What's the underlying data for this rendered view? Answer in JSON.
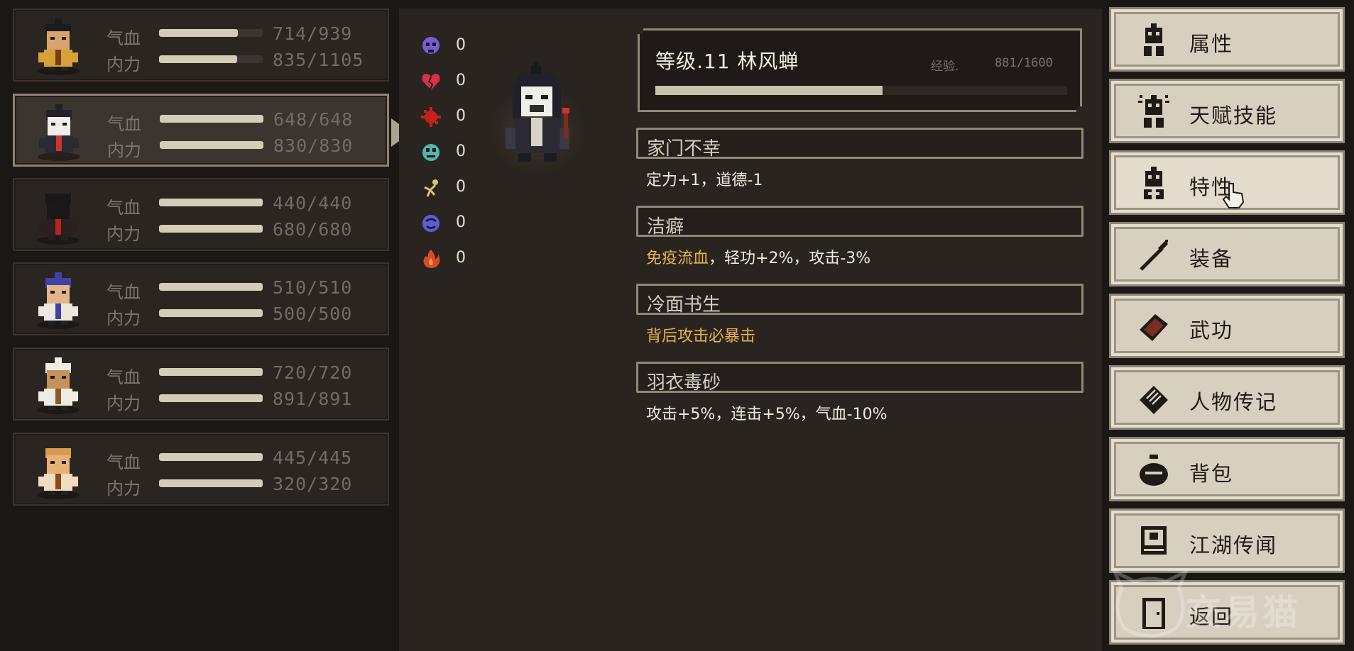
{
  "party": [
    {
      "hp_label": "气血",
      "hp": 714,
      "hp_max": 939,
      "hp_text": "714/939",
      "mp_label": "内力",
      "mp": 835,
      "mp_max": 1105,
      "mp_text": "835/1105",
      "selected": false,
      "avatar": "warrior-portrait"
    },
    {
      "hp_label": "气血",
      "hp": 648,
      "hp_max": 648,
      "hp_text": "648/648",
      "mp_label": "内力",
      "mp": 830,
      "mp_max": 830,
      "mp_text": "830/830",
      "selected": true,
      "avatar": "masked-scholar-portrait"
    },
    {
      "hp_label": "气血",
      "hp": 440,
      "hp_max": 440,
      "hp_text": "440/440",
      "mp_label": "内力",
      "mp": 680,
      "mp_max": 680,
      "mp_text": "680/680",
      "selected": false,
      "avatar": "ninja-portrait"
    },
    {
      "hp_label": "气血",
      "hp": 510,
      "hp_max": 510,
      "hp_text": "510/510",
      "mp_label": "内力",
      "mp": 500,
      "mp_max": 500,
      "mp_text": "500/500",
      "selected": false,
      "avatar": "swordsman-portrait"
    },
    {
      "hp_label": "气血",
      "hp": 720,
      "hp_max": 720,
      "hp_text": "720/720",
      "mp_label": "内力",
      "mp": 891,
      "mp_max": 891,
      "mp_text": "891/891",
      "selected": false,
      "avatar": "monkey-portrait"
    },
    {
      "hp_label": "气血",
      "hp": 445,
      "hp_max": 445,
      "hp_text": "445/445",
      "mp_label": "内力",
      "mp": 320,
      "mp_max": 320,
      "mp_text": "320/320",
      "selected": false,
      "avatar": "fox-portrait"
    }
  ],
  "resistances": [
    {
      "icon": "skull-icon",
      "color": "#7a5bd6",
      "value": "0"
    },
    {
      "icon": "broken-heart-icon",
      "color": "#d8304a",
      "value": "0"
    },
    {
      "icon": "bleed-splat-icon",
      "color": "#c5221c",
      "value": "0"
    },
    {
      "icon": "poison-face-icon",
      "color": "#4fb7b0",
      "value": "0"
    },
    {
      "icon": "stun-figure-icon",
      "color": "#d9c27a",
      "value": "0"
    },
    {
      "icon": "confusion-face-icon",
      "color": "#5a5fd8",
      "value": "0"
    },
    {
      "icon": "burn-flame-icon",
      "color": "#d9482a",
      "value": "0"
    }
  ],
  "character": {
    "title": "等级.11 林风蝉",
    "exp_label": "经验.",
    "exp_text": "881/1600",
    "exp": 881,
    "exp_max": 1600
  },
  "traits": [
    {
      "name": "家门不幸",
      "desc_gold": "",
      "desc": "定力+1，道德-1"
    },
    {
      "name": "洁癖",
      "desc_gold": "免疫流血",
      "desc": "，轻功+2%，攻击-3%"
    },
    {
      "name": "冷面书生",
      "desc_gold": "背后攻击必暴击",
      "desc": ""
    },
    {
      "name": "羽衣毒砂",
      "desc_gold": "",
      "desc": "攻击+5%，连击+5%，气血-10%"
    }
  ],
  "menu": [
    {
      "label": "属性",
      "icon": "attribute-figure-icon"
    },
    {
      "label": "天赋技能",
      "icon": "talent-figure-icon"
    },
    {
      "label": "特性",
      "icon": "trait-figure-icon",
      "hover": true
    },
    {
      "label": "装备",
      "icon": "sword-icon"
    },
    {
      "label": "武功",
      "icon": "martial-book-icon"
    },
    {
      "label": "人物传记",
      "icon": "biography-scroll-icon"
    },
    {
      "label": "背包",
      "icon": "bag-icon"
    },
    {
      "label": "江湖传闻",
      "icon": "notice-board-icon"
    },
    {
      "label": "返回",
      "icon": "door-icon"
    }
  ],
  "watermark": "交易猫",
  "colors": {
    "accent_gold": "#e6b44a",
    "bar_fill": "#d3cdb7",
    "button_bg": "#d7d0bf"
  }
}
